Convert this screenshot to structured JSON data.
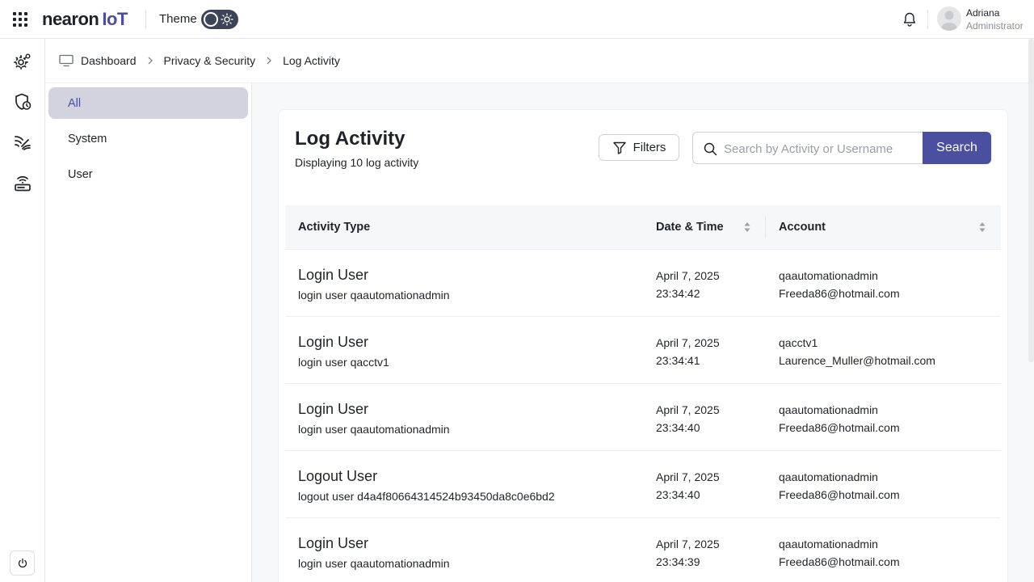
{
  "header": {
    "brand": "nearon",
    "brand_suffix": "IoT",
    "theme_label": "Theme",
    "user": {
      "name": "Adriana",
      "role": "Administrator"
    }
  },
  "icons": {
    "apps": "grid-icon",
    "theme_toggle": "sun-icon",
    "notifications": "bell-icon",
    "rail": [
      "gear-cog-icon",
      "shield-clock-icon",
      "signal-waves-icon",
      "router-wifi-icon"
    ],
    "power": "power-icon"
  },
  "breadcrumb": {
    "items": [
      "Dashboard",
      "Privacy & Security",
      "Log Activity"
    ]
  },
  "subnav": {
    "items": [
      {
        "label": "All",
        "active": true
      },
      {
        "label": "System",
        "active": false
      },
      {
        "label": "User",
        "active": false
      }
    ]
  },
  "panel": {
    "title": "Log Activity",
    "subtitle": "Displaying 10 log activity",
    "filters_label": "Filters",
    "search_placeholder": "Search by Activity or Username",
    "search_label": "Search"
  },
  "table": {
    "columns": [
      "Activity Type",
      "Date & Time",
      "Account"
    ],
    "rows": [
      {
        "title": "Login User",
        "desc": "login user qaautomationadmin",
        "date": "April 7, 2025",
        "time": "23:34:42",
        "user": "qaautomationadmin",
        "email": "Freeda86@hotmail.com"
      },
      {
        "title": "Login User",
        "desc": "login user qacctv1",
        "date": "April 7, 2025",
        "time": "23:34:41",
        "user": "qacctv1",
        "email": "Laurence_Muller@hotmail.com"
      },
      {
        "title": "Login User",
        "desc": "login user qaautomationadmin",
        "date": "April 7, 2025",
        "time": "23:34:40",
        "user": "qaautomationadmin",
        "email": "Freeda86@hotmail.com"
      },
      {
        "title": "Logout User",
        "desc": "logout user d4a4f80664314524b93450da8c0e6bd2",
        "date": "April 7, 2025",
        "time": "23:34:40",
        "user": "qaautomationadmin",
        "email": "Freeda86@hotmail.com"
      },
      {
        "title": "Login User",
        "desc": "login user qaautomationadmin",
        "date": "April 7, 2025",
        "time": "23:34:39",
        "user": "qaautomationadmin",
        "email": "Freeda86@hotmail.com"
      }
    ]
  },
  "colors": {
    "accent": "#4a4fa0",
    "active_nav_bg": "#d2d3de",
    "toggle_bg": "#3c4458"
  }
}
